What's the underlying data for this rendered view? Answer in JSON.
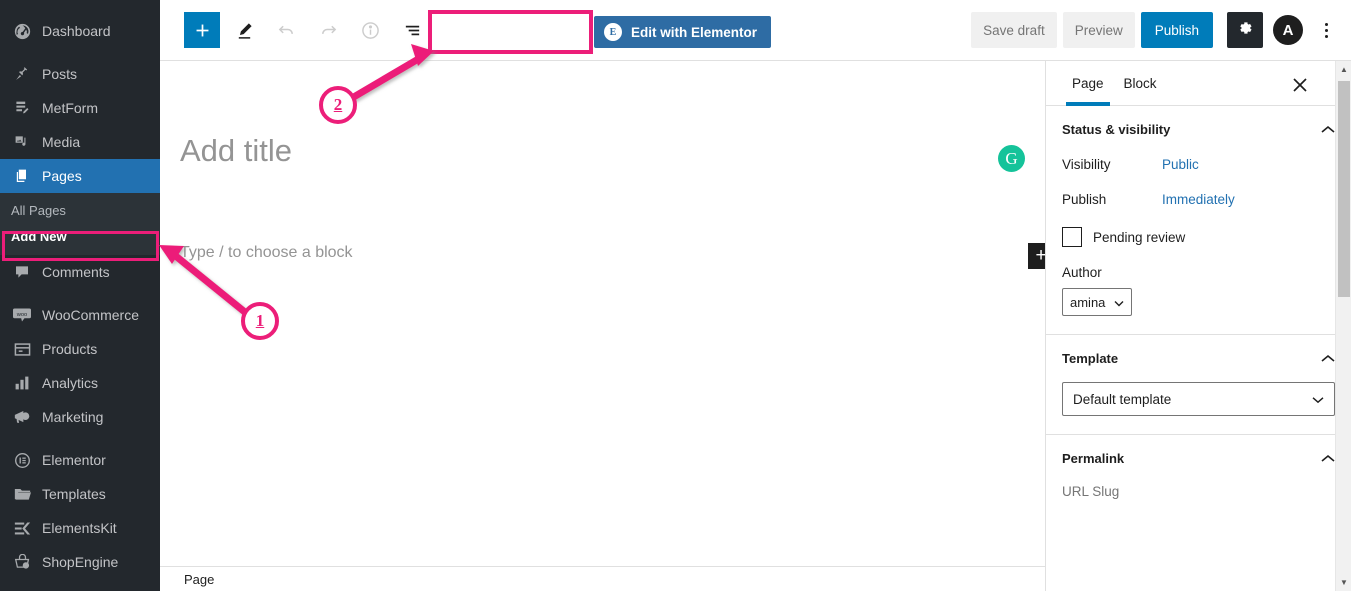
{
  "sidebar": {
    "items": [
      {
        "label": "Dashboard",
        "icon": "dashboard-icon",
        "type": "item"
      },
      {
        "label": "",
        "icon": "",
        "type": "sep"
      },
      {
        "label": "Posts",
        "icon": "pin-icon",
        "type": "item"
      },
      {
        "label": "MetForm",
        "icon": "form-icon",
        "type": "item"
      },
      {
        "label": "Media",
        "icon": "media-icon",
        "type": "item"
      },
      {
        "label": "Pages",
        "icon": "pages-icon",
        "type": "item",
        "active": true
      },
      {
        "label": "Comments",
        "icon": "comment-icon",
        "type": "item"
      },
      {
        "label": "",
        "icon": "",
        "type": "sep"
      },
      {
        "label": "WooCommerce",
        "icon": "woo-icon",
        "type": "item"
      },
      {
        "label": "Products",
        "icon": "products-icon",
        "type": "item"
      },
      {
        "label": "Analytics",
        "icon": "analytics-icon",
        "type": "item"
      },
      {
        "label": "Marketing",
        "icon": "marketing-icon",
        "type": "item"
      },
      {
        "label": "",
        "icon": "",
        "type": "sep"
      },
      {
        "label": "Elementor",
        "icon": "elementor-icon",
        "type": "item"
      },
      {
        "label": "Templates",
        "icon": "folder-icon",
        "type": "item"
      },
      {
        "label": "ElementsKit",
        "icon": "elementskit-icon",
        "type": "item"
      },
      {
        "label": "ShopEngine",
        "icon": "shopengine-icon",
        "type": "item"
      }
    ],
    "submenu": {
      "all_pages": "All Pages",
      "add_new": "Add New"
    }
  },
  "toolbar": {
    "add_block_label": "+",
    "tools_icon": "pencil-icon",
    "undo_icon": "undo-icon",
    "redo_icon": "redo-icon",
    "info_icon": "info-icon",
    "list_view_icon": "list-view-icon",
    "elementor_button": "Edit with Elementor",
    "elementor_badge": "E",
    "save_draft": "Save draft",
    "preview": "Preview",
    "publish": "Publish",
    "settings_icon": "gear-icon",
    "avatar_label": "A",
    "options_icon": "kebab-menu-icon"
  },
  "canvas": {
    "title_placeholder": "Add title",
    "block_placeholder": "Type / to choose a block",
    "grammarly_icon": "G",
    "add_block_icon": "+"
  },
  "statusbar": {
    "breadcrumb": "Page"
  },
  "panel": {
    "tabs": [
      {
        "label": "Page",
        "active": true
      },
      {
        "label": "Block",
        "active": false
      }
    ],
    "close_icon": "close-icon",
    "status_section": {
      "title": "Status & visibility",
      "chevron": "chevron-up-icon",
      "visibility_label": "Visibility",
      "visibility_value": "Public",
      "publish_label": "Publish",
      "publish_value": "Immediately",
      "pending_review_label": "Pending review",
      "author_label": "Author",
      "author_value": "amina"
    },
    "template_section": {
      "title": "Template",
      "chevron": "chevron-up-icon",
      "value": "Default template"
    },
    "permalink_section": {
      "title": "Permalink",
      "chevron": "chevron-up-icon",
      "url_slug_label": "URL Slug"
    }
  },
  "annotations": [
    {
      "number": "1"
    },
    {
      "number": "2"
    }
  ],
  "colors": {
    "accent_blue": "#007cba",
    "sidebar_bg": "#23282d",
    "active_menu": "#2271b1",
    "highlight_pink": "#ec1e79",
    "elementor_blue": "#2e6ca4",
    "grammarly_green": "#15c39a"
  }
}
